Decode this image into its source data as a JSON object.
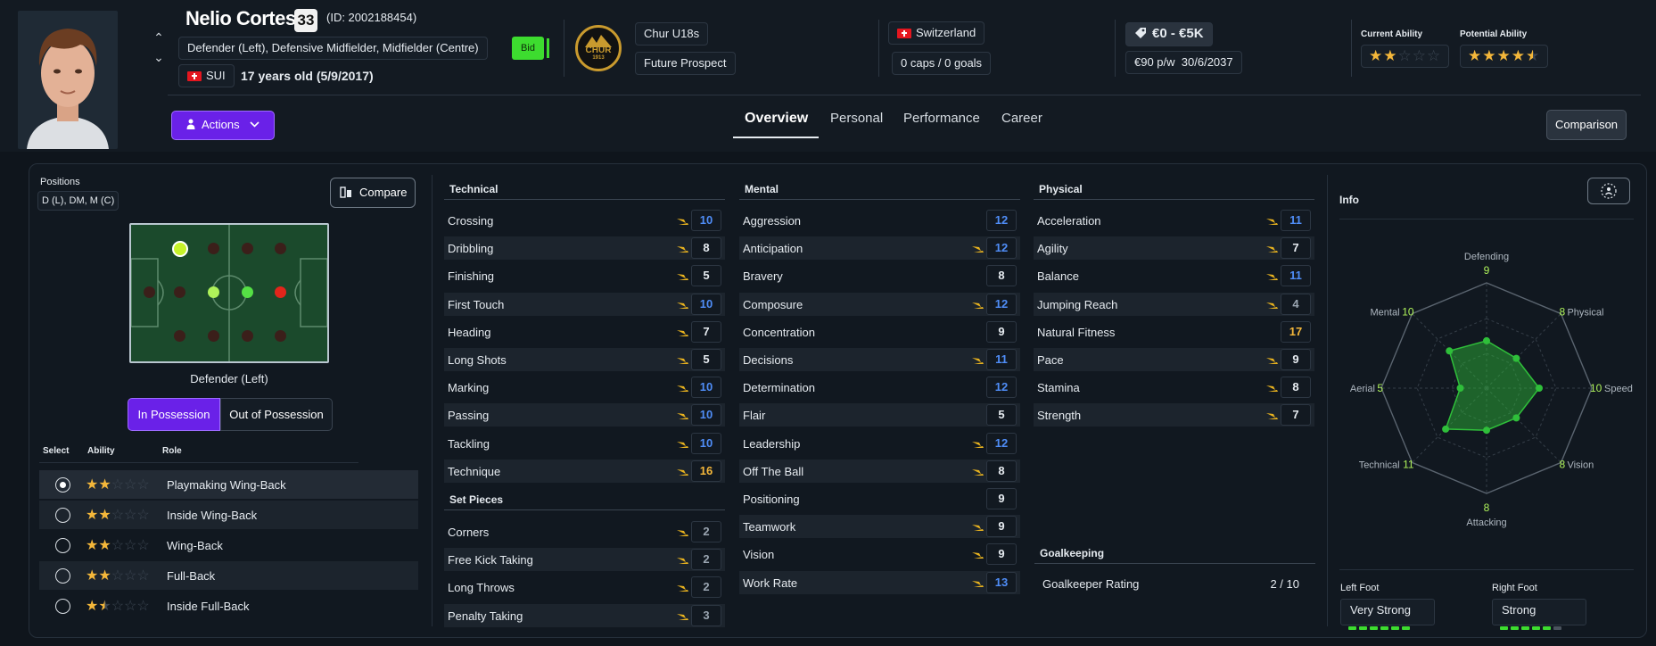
{
  "player": {
    "name": "Nelio Cortesi",
    "shirt_number": "33",
    "id_text": "(ID: 2002188454)",
    "positions_text": "Defender (Left), Defensive Midfielder, Midfielder (Centre)",
    "nationality_code": "SUI",
    "age_text": "17 years old (5/9/2017)",
    "bid_label": "Bid"
  },
  "club": {
    "logo_text": "CHUR",
    "logo_year": "1913",
    "team": "Chur U18s",
    "status": "Future Prospect"
  },
  "international": {
    "country": "Switzerland",
    "caps": "0 caps / 0 goals"
  },
  "contract": {
    "value": "€0 - €5K",
    "wage": "€90 p/w",
    "expiry": "30/6/2037"
  },
  "abilities": {
    "current_label": "Current Ability",
    "current_stars": 2,
    "potential_label": "Potential Ability",
    "potential_stars": 4.5
  },
  "nav": {
    "actions_label": "Actions",
    "tabs": [
      "Overview",
      "Personal",
      "Performance",
      "Career"
    ],
    "active_tab": "Overview",
    "comparison_label": "Comparison"
  },
  "positions_panel": {
    "title": "Positions",
    "short": "D (L), DM, M (C)",
    "compare_label": "Compare",
    "selected_position": "Defender (Left)",
    "in_possession": "In Possession",
    "out_of_possession": "Out of Possession",
    "headers": {
      "select": "Select",
      "ability": "Ability",
      "role": "Role"
    },
    "roles": [
      {
        "name": "Playmaking Wing-Back",
        "stars": 2,
        "selected": true
      },
      {
        "name": "Inside Wing-Back",
        "stars": 2,
        "selected": false
      },
      {
        "name": "Wing-Back",
        "stars": 2,
        "selected": false
      },
      {
        "name": "Full-Back",
        "stars": 2,
        "selected": false
      },
      {
        "name": "Inside Full-Back",
        "stars": 1.5,
        "selected": false
      }
    ]
  },
  "attributes": {
    "technical_title": "Technical",
    "technical": [
      {
        "name": "Crossing",
        "value": 10
      },
      {
        "name": "Dribbling",
        "value": 8
      },
      {
        "name": "Finishing",
        "value": 5
      },
      {
        "name": "First Touch",
        "value": 10
      },
      {
        "name": "Heading",
        "value": 7
      },
      {
        "name": "Long Shots",
        "value": 5
      },
      {
        "name": "Marking",
        "value": 10
      },
      {
        "name": "Passing",
        "value": 10
      },
      {
        "name": "Tackling",
        "value": 10
      },
      {
        "name": "Technique",
        "value": 16
      }
    ],
    "set_pieces_title": "Set Pieces",
    "set_pieces": [
      {
        "name": "Corners",
        "value": 2
      },
      {
        "name": "Free Kick Taking",
        "value": 2
      },
      {
        "name": "Long Throws",
        "value": 2
      },
      {
        "name": "Penalty Taking",
        "value": 3
      }
    ],
    "mental_title": "Mental",
    "mental": [
      {
        "name": "Aggression",
        "value": 12
      },
      {
        "name": "Anticipation",
        "value": 12
      },
      {
        "name": "Bravery",
        "value": 8
      },
      {
        "name": "Composure",
        "value": 12
      },
      {
        "name": "Concentration",
        "value": 9
      },
      {
        "name": "Decisions",
        "value": 11
      },
      {
        "name": "Determination",
        "value": 12
      },
      {
        "name": "Flair",
        "value": 5
      },
      {
        "name": "Leadership",
        "value": 12
      },
      {
        "name": "Off The Ball",
        "value": 8
      },
      {
        "name": "Positioning",
        "value": 9
      },
      {
        "name": "Teamwork",
        "value": 9
      },
      {
        "name": "Vision",
        "value": 9
      },
      {
        "name": "Work Rate",
        "value": 13
      }
    ],
    "physical_title": "Physical",
    "physical": [
      {
        "name": "Acceleration",
        "value": 11
      },
      {
        "name": "Agility",
        "value": 7
      },
      {
        "name": "Balance",
        "value": 11
      },
      {
        "name": "Jumping Reach",
        "value": 4
      },
      {
        "name": "Natural Fitness",
        "value": 17
      },
      {
        "name": "Pace",
        "value": 9
      },
      {
        "name": "Stamina",
        "value": 8
      },
      {
        "name": "Strength",
        "value": 7
      }
    ],
    "goalkeeping_title": "Goalkeeping",
    "goalkeeper_rating_label": "Goalkeeper Rating",
    "goalkeeper_rating_value": "2 / 10"
  },
  "info": {
    "title": "Info",
    "radar": [
      {
        "label": "Defending",
        "value": 9
      },
      {
        "label": "Physical",
        "value": 8
      },
      {
        "label": "Speed",
        "value": 10
      },
      {
        "label": "Vision",
        "value": 8
      },
      {
        "label": "Attacking",
        "value": 8
      },
      {
        "label": "Technical",
        "value": 11
      },
      {
        "label": "Aerial",
        "value": 5
      },
      {
        "label": "Mental",
        "value": 10
      }
    ],
    "left_foot_label": "Left Foot",
    "left_foot_value": "Very Strong",
    "left_foot_level": 6,
    "right_foot_label": "Right Foot",
    "right_foot_value": "Strong",
    "right_foot_level": 5,
    "foot_level_max": 6
  },
  "colors": {
    "accent_purple": "#6a21e8",
    "bid_green": "#3ddc2f",
    "value_blue": "#4f8df7",
    "value_grey": "#9aa5b1",
    "value_gold": "#f4b73a",
    "value_white": "#e6ebf0",
    "star": "#f4b73a",
    "radar_fill": "#2fbf3a"
  }
}
